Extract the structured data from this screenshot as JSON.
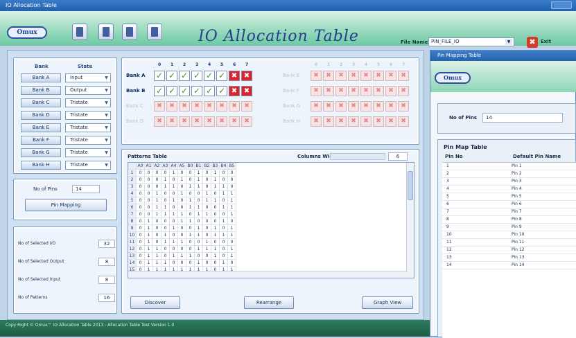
{
  "window": {
    "title": "IO Allocation Table"
  },
  "toolbar": {
    "logo": "Omux",
    "app_title": "IO Allocation Table",
    "file_name_label": "File Name",
    "file_name_value": "PIN_FILE_IO",
    "exit_label": "Exit"
  },
  "bank_config": {
    "header_bank": "Bank",
    "header_state": "State",
    "banks": [
      {
        "name": "Bank A",
        "state": "Input"
      },
      {
        "name": "Bank B",
        "state": "Output"
      },
      {
        "name": "Bank C",
        "state": "Tristate"
      },
      {
        "name": "Bank D",
        "state": "Tristate"
      },
      {
        "name": "Bank E",
        "state": "Tristate"
      },
      {
        "name": "Bank F",
        "state": "Tristate"
      },
      {
        "name": "Bank G",
        "state": "Tristate"
      },
      {
        "name": "Bank H",
        "state": "Tristate"
      }
    ]
  },
  "pins": {
    "label": "No of Pins",
    "value": "14",
    "pin_mapping_button": "Pin Mapping"
  },
  "counts": [
    {
      "label": "No of Selected I/O",
      "value": "32"
    },
    {
      "label": "No of Selected Output",
      "value": "8"
    },
    {
      "label": "No of Selected Input",
      "value": "8"
    },
    {
      "label": "No of Patterns",
      "value": "16"
    }
  ],
  "io_grid": {
    "col_numbers": [
      "0",
      "1",
      "2",
      "3",
      "4",
      "5",
      "6",
      "7"
    ],
    "active_rows": [
      {
        "label": "Bank A",
        "cells": [
          "ok",
          "ok",
          "ok",
          "ok",
          "ok",
          "ok",
          "no",
          "no"
        ]
      },
      {
        "label": "Bank B",
        "cells": [
          "ok",
          "ok",
          "ok",
          "ok",
          "ok",
          "ok",
          "no",
          "no"
        ]
      }
    ],
    "dim_rows_left": [
      "Bank C",
      "Bank D"
    ],
    "dim_rows_right": [
      "Bank E",
      "Bank F",
      "Bank G",
      "Bank H"
    ]
  },
  "pattern_table": {
    "title": "Patterns Table",
    "column_label": "Columns Width",
    "column_value": "6",
    "headers": [
      "A0",
      "A1",
      "A2",
      "A3",
      "A4",
      "A5",
      "B0",
      "B1",
      "B2",
      "B3",
      "B4",
      "B5"
    ],
    "rows": [
      [
        "1",
        "0",
        "0",
        "0",
        "0",
        "1",
        "0",
        "0",
        "1",
        "0",
        "1",
        "0",
        "0"
      ],
      [
        "2",
        "0",
        "0",
        "0",
        "1",
        "0",
        "1",
        "0",
        "1",
        "0",
        "1",
        "0",
        "0"
      ],
      [
        "3",
        "0",
        "0",
        "0",
        "1",
        "1",
        "0",
        "1",
        "1",
        "0",
        "1",
        "1",
        "0"
      ],
      [
        "4",
        "0",
        "0",
        "1",
        "0",
        "0",
        "1",
        "0",
        "0",
        "1",
        "0",
        "1",
        "1"
      ],
      [
        "5",
        "0",
        "0",
        "1",
        "0",
        "1",
        "0",
        "1",
        "0",
        "1",
        "1",
        "0",
        "1"
      ],
      [
        "6",
        "0",
        "0",
        "1",
        "1",
        "0",
        "0",
        "1",
        "1",
        "0",
        "0",
        "1",
        "1"
      ],
      [
        "7",
        "0",
        "0",
        "1",
        "1",
        "1",
        "1",
        "0",
        "1",
        "1",
        "0",
        "0",
        "1"
      ],
      [
        "8",
        "0",
        "1",
        "0",
        "0",
        "0",
        "1",
        "1",
        "0",
        "0",
        "0",
        "1",
        "0"
      ],
      [
        "9",
        "0",
        "1",
        "0",
        "0",
        "1",
        "0",
        "0",
        "1",
        "0",
        "1",
        "0",
        "1"
      ],
      [
        "10",
        "0",
        "1",
        "0",
        "1",
        "0",
        "0",
        "1",
        "1",
        "0",
        "1",
        "1",
        "1"
      ],
      [
        "11",
        "0",
        "1",
        "0",
        "1",
        "1",
        "1",
        "0",
        "0",
        "1",
        "0",
        "0",
        "0"
      ],
      [
        "12",
        "0",
        "1",
        "1",
        "0",
        "0",
        "0",
        "0",
        "1",
        "1",
        "1",
        "0",
        "1"
      ],
      [
        "13",
        "0",
        "1",
        "1",
        "0",
        "1",
        "1",
        "1",
        "0",
        "0",
        "1",
        "0",
        "1"
      ],
      [
        "14",
        "0",
        "1",
        "1",
        "1",
        "0",
        "0",
        "0",
        "1",
        "0",
        "0",
        "1",
        "0"
      ],
      [
        "15",
        "0",
        "1",
        "1",
        "1",
        "1",
        "1",
        "1",
        "1",
        "1",
        "0",
        "1",
        "1"
      ]
    ],
    "buttons": [
      "Discover",
      "Rearrange",
      "Graph View"
    ]
  },
  "status_bar": "Copy Right © Omux™ IO Allocation Table 2013 - Allocation Table Test Version 1.0",
  "pin_map_window": {
    "title": "Pin Mapping Table",
    "logo": "Omux",
    "pins_label": "No of Pins",
    "pins_value": "14",
    "table_title": "Pin Map Table",
    "col_pin": "Pin No",
    "col_name": "Default Pin Name",
    "rows": [
      [
        "1",
        "Pin 1"
      ],
      [
        "2",
        "Pin 2"
      ],
      [
        "3",
        "Pin 3"
      ],
      [
        "4",
        "Pin 4"
      ],
      [
        "5",
        "Pin 5"
      ],
      [
        "6",
        "Pin 6"
      ],
      [
        "7",
        "Pin 7"
      ],
      [
        "8",
        "Pin 8"
      ],
      [
        "9",
        "Pin 9"
      ],
      [
        "10",
        "Pin 10"
      ],
      [
        "11",
        "Pin 11"
      ],
      [
        "12",
        "Pin 12"
      ],
      [
        "13",
        "Pin 13"
      ],
      [
        "14",
        "Pin 14"
      ]
    ]
  }
}
